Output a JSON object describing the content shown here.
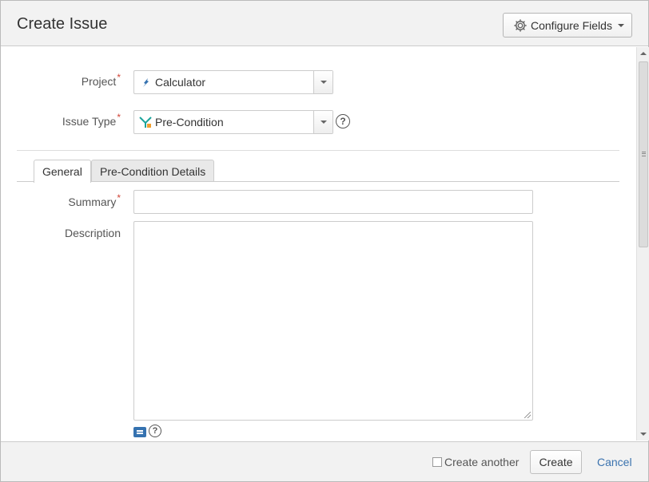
{
  "dialog": {
    "title": "Create Issue",
    "configure_fields_label": "Configure Fields"
  },
  "form": {
    "project": {
      "label": "Project",
      "required_marker": "*",
      "value": "Calculator",
      "icon": "rocket-icon"
    },
    "issue_type": {
      "label": "Issue Type",
      "required_marker": "*",
      "value": "Pre-Condition",
      "icon": "precondition-icon"
    },
    "tabs": [
      {
        "label": "General",
        "active": true
      },
      {
        "label": "Pre-Condition Details",
        "active": false
      }
    ],
    "summary": {
      "label": "Summary",
      "required_marker": "*",
      "value": ""
    },
    "description": {
      "label": "Description",
      "value": ""
    }
  },
  "footer": {
    "create_another_label": "Create another",
    "create_another_checked": false,
    "create_label": "Create",
    "cancel_label": "Cancel"
  },
  "colors": {
    "required": "#d04437",
    "link": "#3b73af",
    "header_bg": "#f2f2f2"
  }
}
